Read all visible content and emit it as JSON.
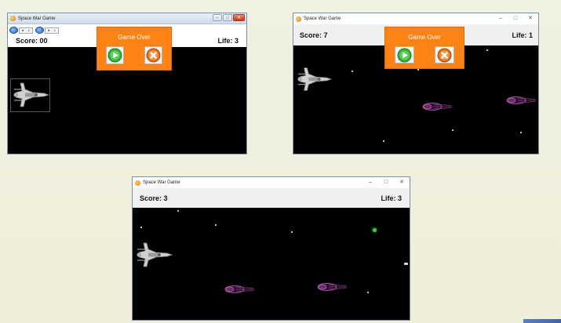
{
  "window_title": "Space War Game",
  "windows": [
    {
      "score_label": "Score:",
      "score": "00",
      "life_label": "Life:",
      "life": "3",
      "game_over": "Game Over",
      "toolbar": [
        "■ ... ▸",
        "■ ... ▸"
      ]
    },
    {
      "score_label": "Score:",
      "score": "7",
      "life_label": "Life:",
      "life": "1",
      "game_over": "Game Over"
    },
    {
      "score_label": "Score:",
      "score": "3",
      "life_label": "Life:",
      "life": "3"
    }
  ],
  "caption_buttons": {
    "minimize": "–",
    "maximize": "□",
    "close": "✕"
  },
  "colors": {
    "field": "#000000",
    "game_over_panel": "#ff8214",
    "play_button": "#3cb43c",
    "quit_button": "#e8741e",
    "enemy_ship": "#a8509c",
    "bullet": "#2ed23a"
  },
  "icons": [
    "space-war-app-icon",
    "play-icon",
    "close-icon",
    "player-spaceship-icon",
    "enemy-ship-icon",
    "star-icon",
    "bullet-icon"
  ]
}
